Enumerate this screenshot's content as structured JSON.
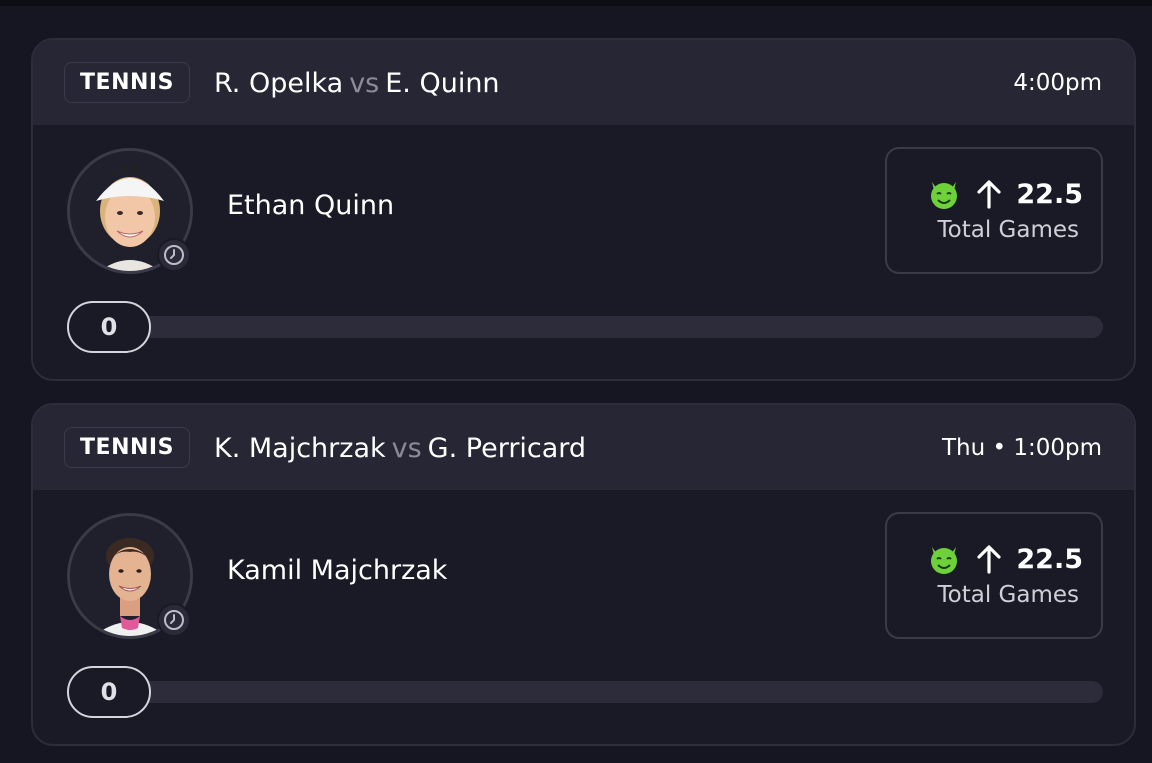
{
  "colors": {
    "background": "#161622",
    "card": "#1a1a26",
    "header": "#262634",
    "muted": "#8b8b9a",
    "accent_green": "#6fd13a"
  },
  "cards": [
    {
      "sport": "TENNIS",
      "player1": "R. Opelka",
      "vs": "vs",
      "player2": "E. Quinn",
      "time": "4:00pm",
      "player_name": "Ethan Quinn",
      "avatar_icon": "player-photo",
      "status_icon": "clock-icon",
      "pick_icon": "demon-icon",
      "direction_icon": "arrow-up-icon",
      "line": "22.5",
      "stat": "Total Games",
      "progress_value": "0",
      "progress_fraction": 0
    },
    {
      "sport": "TENNIS",
      "player1": "K. Majchrzak",
      "vs": "vs",
      "player2": "G. Perricard",
      "time": "Thu • 1:00pm",
      "player_name": "Kamil Majchrzak",
      "avatar_icon": "player-photo",
      "status_icon": "clock-icon",
      "pick_icon": "demon-icon",
      "direction_icon": "arrow-up-icon",
      "line": "22.5",
      "stat": "Total Games",
      "progress_value": "0",
      "progress_fraction": 0
    }
  ]
}
